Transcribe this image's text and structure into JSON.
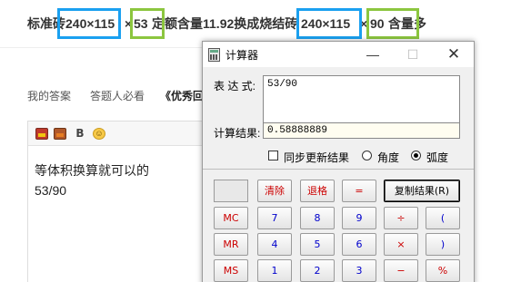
{
  "question": {
    "part1": "标准砖",
    "size1": "240×115",
    "part2": "×",
    "num1": "53",
    "part3": "定额含量11.92换成烧结砖",
    "size2": "240×115",
    "part4": "×",
    "num2": "90",
    "part5": "含量多",
    "highlight_colors": {
      "blue": "#1aa0f0",
      "green": "#8cc63f"
    }
  },
  "tabs": [
    "我的答案",
    "答题人必看",
    "《优秀回"
  ],
  "editor": {
    "toolbar_icons": [
      "image-icon",
      "image-upload-icon",
      "bold-icon",
      "emoji-icon"
    ],
    "bold_label": "B",
    "emoji_glyph": "☺",
    "lines": [
      "等体积换算就可以的",
      "53/90"
    ]
  },
  "calculator": {
    "title": "计算器",
    "window_buttons": {
      "minimize": "—",
      "maximize": "☐",
      "close": "✕"
    },
    "expression_label": "表 达 式:",
    "expression_value": "53/90",
    "result_label": "计算结果:",
    "result_value": "0.58888889",
    "sync_label": "同步更新结果",
    "sync_checked": false,
    "angle_mode": {
      "degree": "角度",
      "radian": "弧度",
      "selected": "radian"
    },
    "buttons": {
      "clear": "清除",
      "backspace": "退格",
      "equals": "=",
      "copy_result": "复制结果(R)",
      "mc": "MC",
      "mr": "MR",
      "ms": "MS",
      "d7": "7",
      "d8": "8",
      "d9": "9",
      "d4": "4",
      "d5": "5",
      "d6": "6",
      "d1": "1",
      "d2": "2",
      "d3": "3",
      "divide": "÷",
      "multiply": "×",
      "minus": "−",
      "lparen": "(",
      "rparen": ")",
      "percent": "%"
    }
  }
}
